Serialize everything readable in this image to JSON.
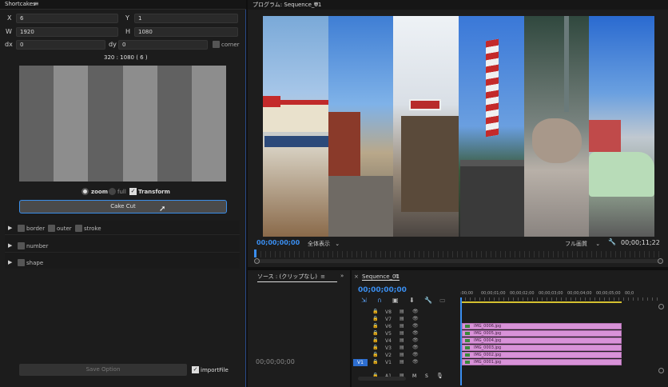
{
  "left_panel": {
    "title": "Shortcakes",
    "fields": {
      "x_label": "X",
      "x_value": "6",
      "y_label": "Y",
      "y_value": "1",
      "w_label": "W",
      "w_value": "1920",
      "h_label": "H",
      "h_value": "1080",
      "dx_label": "dx",
      "dx_value": "0",
      "dy_label": "dy",
      "dy_value": "0",
      "corner_label": "corner"
    },
    "size_readout": "320 : 1080 ( 6 )",
    "options": {
      "zoom": "zoom",
      "full": "full",
      "transform": "Transform"
    },
    "cake_cut_button": "Cake Cut",
    "sections": [
      "border",
      "number",
      "shape"
    ],
    "border_options": [
      "outer",
      "stroke"
    ],
    "save_button": "Save Option",
    "import_label": "importFile"
  },
  "program_monitor": {
    "title": "プログラム: Sequence_01",
    "timecode_left": "00;00;00;00",
    "fit_label": "全体表示",
    "quality_label": "フル画質",
    "timecode_right": "00;00;11;22"
  },
  "source_monitor": {
    "tab_label": "ソース : (クリップなし)",
    "timecode": "00;00;00;00"
  },
  "timeline": {
    "tab_label": "Sequence_01",
    "timecode": "00;00;00;00",
    "ruler_labels": [
      ":00;00",
      "00;00;01;00",
      "00;00;02;00",
      "00;00;03;00",
      "00;00;04;00",
      "00;00;05;00",
      "00;0"
    ],
    "tracks": [
      "V8",
      "V7",
      "V6",
      "V5",
      "V4",
      "V3",
      "V2",
      "V1",
      "A1"
    ],
    "clips": [
      "IMG_0006.jpg",
      "IMG_0005.jpg",
      "IMG_0004.jpg",
      "IMG_0003.jpg",
      "IMG_0002.jpg",
      "IMG_0001.jpg"
    ],
    "audio_m": "M",
    "audio_s": "S"
  },
  "colors": {
    "accent": "#2d8cf0",
    "clip": "#d892d8",
    "panel_bg": "#1c1c1c"
  }
}
